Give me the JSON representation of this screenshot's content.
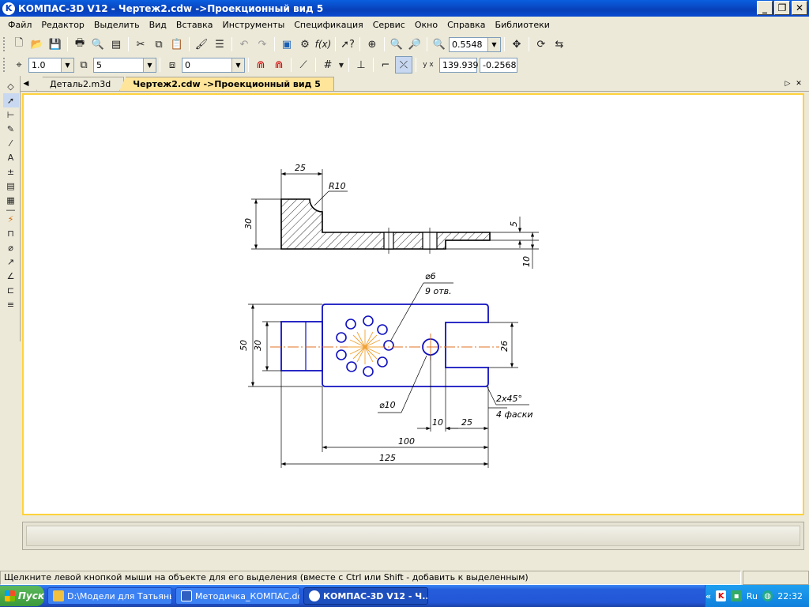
{
  "window": {
    "title": "КОМПАС-3D V12 - Чертеж2.cdw ->Проекционный вид 5",
    "logo": "K"
  },
  "menu": [
    "Файл",
    "Редактор",
    "Выделить",
    "Вид",
    "Вставка",
    "Инструменты",
    "Спецификация",
    "Сервис",
    "Окно",
    "Справка",
    "Библиотеки"
  ],
  "toolbar_main": {
    "zoom_value": "0.5548"
  },
  "toolbar_props": {
    "step_value": "1.0",
    "layer_value": "5",
    "style_value": "0",
    "coord_x": "139.939",
    "coord_y": "-0.2568"
  },
  "tabs": [
    {
      "label": "Деталь2.m3d",
      "active": false
    },
    {
      "label": "Чертеж2.cdw ->Проекционный вид 5",
      "active": true
    }
  ],
  "drawing": {
    "dims": {
      "d25_top": "25",
      "r10": "R10",
      "d30_left": "30",
      "d5": "5",
      "d10_right": "10",
      "d6": "⌀6",
      "holes": "9 отв.",
      "d50": "50",
      "d30_plan": "30",
      "d26": "26",
      "d10_dia": "⌀10",
      "chamfer": "2x45°",
      "chamfer_count": "4 фаски",
      "d10_bottom": "10",
      "d25_bottom": "25",
      "d100": "100",
      "d125": "125"
    }
  },
  "status": {
    "text": "Щелкните левой кнопкой мыши на объекте для его выделения (вместе с Ctrl или Shift - добавить к выделенным)"
  },
  "taskbar": {
    "start": "Пуск",
    "items": [
      {
        "label": "D:\\Модели для Татьяны...",
        "active": false
      },
      {
        "label": "Методичка_КОМПАС.do...",
        "active": false
      },
      {
        "label": "КОМПАС-3D V12 - Ч...",
        "active": true
      }
    ],
    "tray_lang": "Ru",
    "clock": "22:32"
  }
}
